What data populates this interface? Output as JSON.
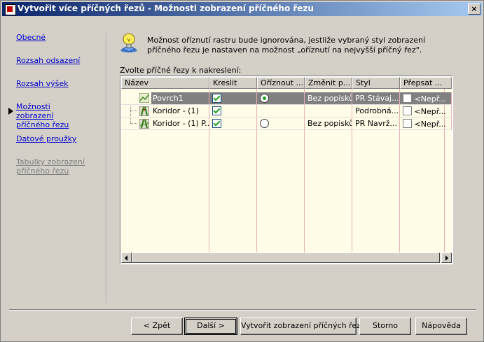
{
  "window": {
    "title": "Vytvořit více příčných řezů - Možnosti zobrazení příčného řezu",
    "close_label": "×"
  },
  "nav": {
    "items": [
      {
        "label": "Obecné",
        "enabled": true
      },
      {
        "label": "Rozsah odsazení",
        "enabled": true
      },
      {
        "label": "Rozsah výšek",
        "enabled": true
      },
      {
        "label": "Možnosti zobrazení příčného řezu",
        "enabled": true,
        "current": true
      },
      {
        "label": "Datové proužky",
        "enabled": true
      },
      {
        "label": "Tabulky zobrazení příčného řezu",
        "enabled": false
      }
    ]
  },
  "info": {
    "text": "Možnost oříznutí rastru bude ignorována, jestliže vybraný styl zobrazení příčného řezu je nastaven na možnost „oříznutí na nejvyšší příčný řez\"."
  },
  "grid": {
    "label": "Zvolte příčné řezy k nakreslení:",
    "columns": [
      "Název",
      "Kreslit",
      "Oříznout ...",
      "Změnit p...",
      "Styl",
      "Přepsat ..."
    ],
    "rows": [
      {
        "name": "Povrch1",
        "draw": true,
        "clip": true,
        "change": "Bez popisků",
        "style": "PR Stávaj...",
        "override": false,
        "override_text": "<Nepř...",
        "selected": true
      },
      {
        "name": "Koridor - (1)",
        "draw": true,
        "clip": null,
        "change": "",
        "style": "Podrobná...",
        "override": false,
        "override_text": "<Nepř...",
        "selected": false
      },
      {
        "name": "Koridor - (1) P...",
        "draw": true,
        "clip": false,
        "change": "Bez popisků",
        "style": "PR Navrž...",
        "override": false,
        "override_text": "<Nepř...",
        "selected": false
      }
    ]
  },
  "buttons": {
    "back": "< Zpět",
    "next": "Další >",
    "create": "Vytvořit zobrazení příčných řezů",
    "cancel": "Storno",
    "help": "Nápověda"
  },
  "colors": {
    "title_start": "#0a246a",
    "title_end": "#a6caf0",
    "link": "#0000cc",
    "grid_bg": "#fffde8",
    "check_green": "#21a121"
  }
}
